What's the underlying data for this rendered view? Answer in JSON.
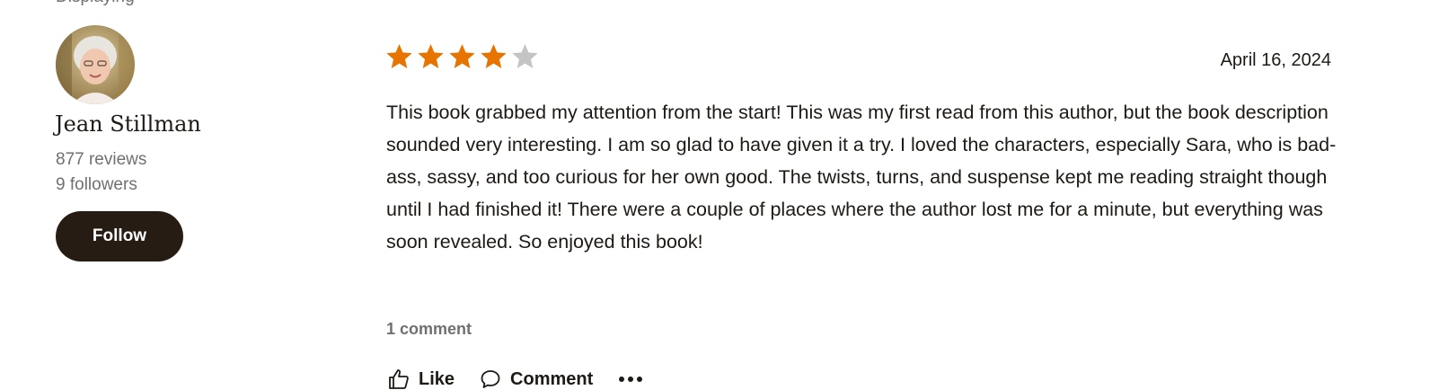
{
  "truncated_text": "Displaying",
  "reviewer": {
    "name": "Jean Stillman",
    "reviews": "877 reviews",
    "followers": "9 followers",
    "follow_label": "Follow"
  },
  "review": {
    "rating": 4,
    "rating_max": 5,
    "date": "April 16, 2024",
    "text": "This book grabbed my attention from the start! This was my first read from this author, but the book description sounded very interesting. I am so glad to have given it a try. I loved the characters, especially Sara, who is bad-ass, sassy, and too curious for her own good. The twists, turns, and suspense kept me reading straight though until I had finished it! There were a couple of places where the author lost me for a minute, but everything was soon revealed. So enjoyed this book!",
    "comment_count": "1 comment"
  },
  "actions": {
    "like_label": "Like",
    "comment_label": "Comment"
  },
  "icons": {
    "star_filled": "star-filled-icon",
    "star_empty": "star-empty-icon",
    "like": "thumbs-up-icon",
    "comment": "speech-bubble-icon",
    "more": "ellipsis-icon"
  },
  "colors": {
    "star_filled": "#e87400",
    "star_empty": "#c4c4c4",
    "follow_button_bg": "#271c14",
    "muted_text": "#707070",
    "body_text": "#1e1915"
  }
}
